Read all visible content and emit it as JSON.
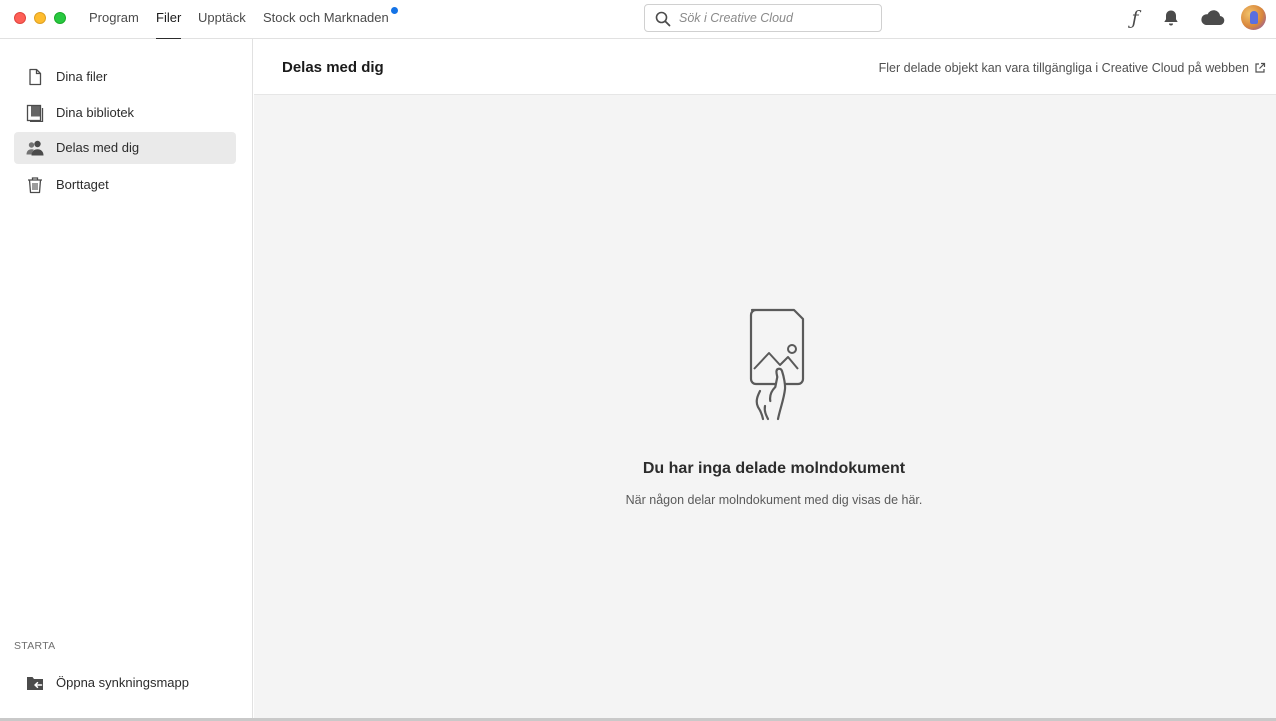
{
  "window": {
    "traffic_lights": {
      "close": "#fe5f57",
      "minimize": "#febc2e",
      "maximize": "#28c840"
    }
  },
  "nav": {
    "tabs": [
      {
        "label": "Program",
        "active": false
      },
      {
        "label": "Filer",
        "active": true
      },
      {
        "label": "Upptäck",
        "active": false
      },
      {
        "label": "Stock och Marknaden",
        "active": false,
        "notification_dot": true
      }
    ],
    "dot_color": "#1473e6"
  },
  "search": {
    "placeholder": "Sök i Creative Cloud",
    "value": ""
  },
  "top_icons": [
    "fonts-icon",
    "bell-icon",
    "cloud-icon",
    "avatar"
  ],
  "sidebar": {
    "items": [
      {
        "label": "Dina filer",
        "icon": "file-icon",
        "selected": false
      },
      {
        "label": "Dina bibliotek",
        "icon": "library-icon",
        "selected": false
      },
      {
        "label": "Delas med dig",
        "icon": "shared-people-icon",
        "selected": true
      },
      {
        "label": "Borttaget",
        "icon": "trash-icon",
        "selected": false
      }
    ],
    "section_label": "STARTA",
    "bottom_item": {
      "label": "Öppna synkningsmapp",
      "icon": "sync-folder-icon"
    }
  },
  "main": {
    "title": "Delas med dig",
    "web_link": "Fler delade objekt kan vara tillgängliga i Creative Cloud på webben",
    "empty_state": {
      "title": "Du har inga delade molndokument",
      "subtitle": "När någon delar molndokument med dig visas de här.",
      "illustration": "hand-holding-image-document-icon"
    }
  }
}
